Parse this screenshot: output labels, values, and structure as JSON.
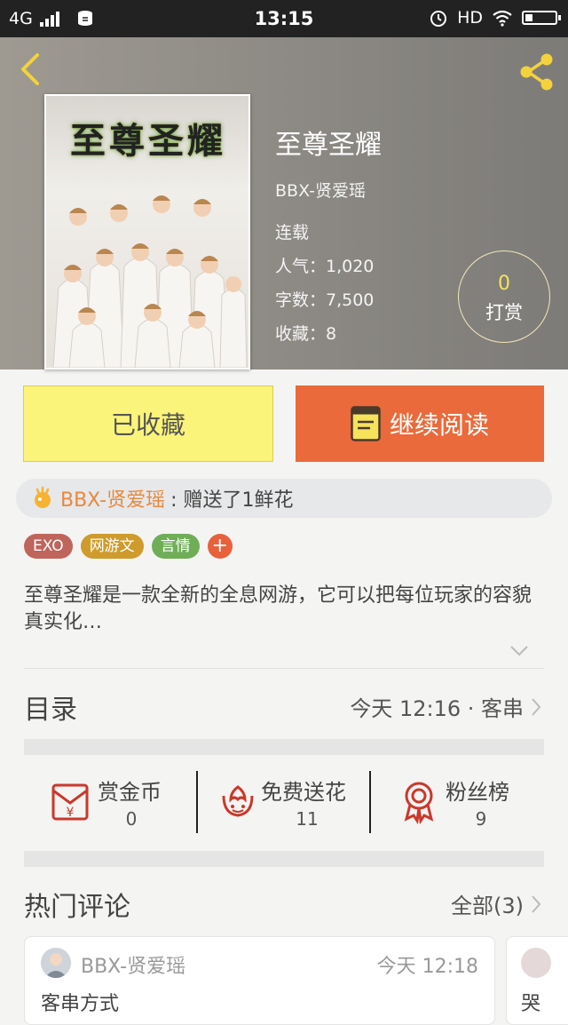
{
  "status_bar": {
    "network": "4G",
    "time": "13:15",
    "hd": "HD"
  },
  "book": {
    "cover_text": "至尊圣耀",
    "title": "至尊圣耀",
    "author": "BBX-贤爱瑶",
    "status": "连载",
    "popularity": "人气：1,020",
    "word_count": "字数：7,500",
    "favorites": "收藏：8",
    "reward_count": "0",
    "reward_label": "打赏"
  },
  "actions": {
    "collect_label": "已收藏",
    "read_label": "继续阅读"
  },
  "gift": {
    "user": "BBX-贤爱瑶",
    "message": ": 赠送了1鲜花"
  },
  "tags": [
    {
      "label": "EXO",
      "color": "#c0655c"
    },
    {
      "label": "网游文",
      "color": "#cf9b2c"
    },
    {
      "label": "言情",
      "color": "#6fae57"
    }
  ],
  "tag_add_label": "+",
  "intro": "至尊圣耀是一款全新的全息网游，它可以把每位玩家的容貌真实化…",
  "toc": {
    "title": "目录",
    "latest": "今天 12:16 · 客串"
  },
  "stats": [
    {
      "label": "赏金币",
      "value": "0",
      "icon": "red-envelope-icon"
    },
    {
      "label": "免费送花",
      "value": "11",
      "icon": "flower-icon"
    },
    {
      "label": "粉丝榜",
      "value": "9",
      "icon": "medal-icon"
    }
  ],
  "hot_comments": {
    "title": "热门评论",
    "all_label": "全部(3)",
    "items": [
      {
        "user": "BBX-贤爱瑶",
        "time": "今天 12:18",
        "text": "客串方式"
      },
      {
        "text": "哭"
      }
    ]
  },
  "colors": {
    "accent_orange": "#ea6a3b",
    "collect_yellow": "#fbf47a",
    "icon_red": "#c9392b",
    "gift_user": "#e8883c",
    "header_icon_yellow": "#f3d23c"
  }
}
